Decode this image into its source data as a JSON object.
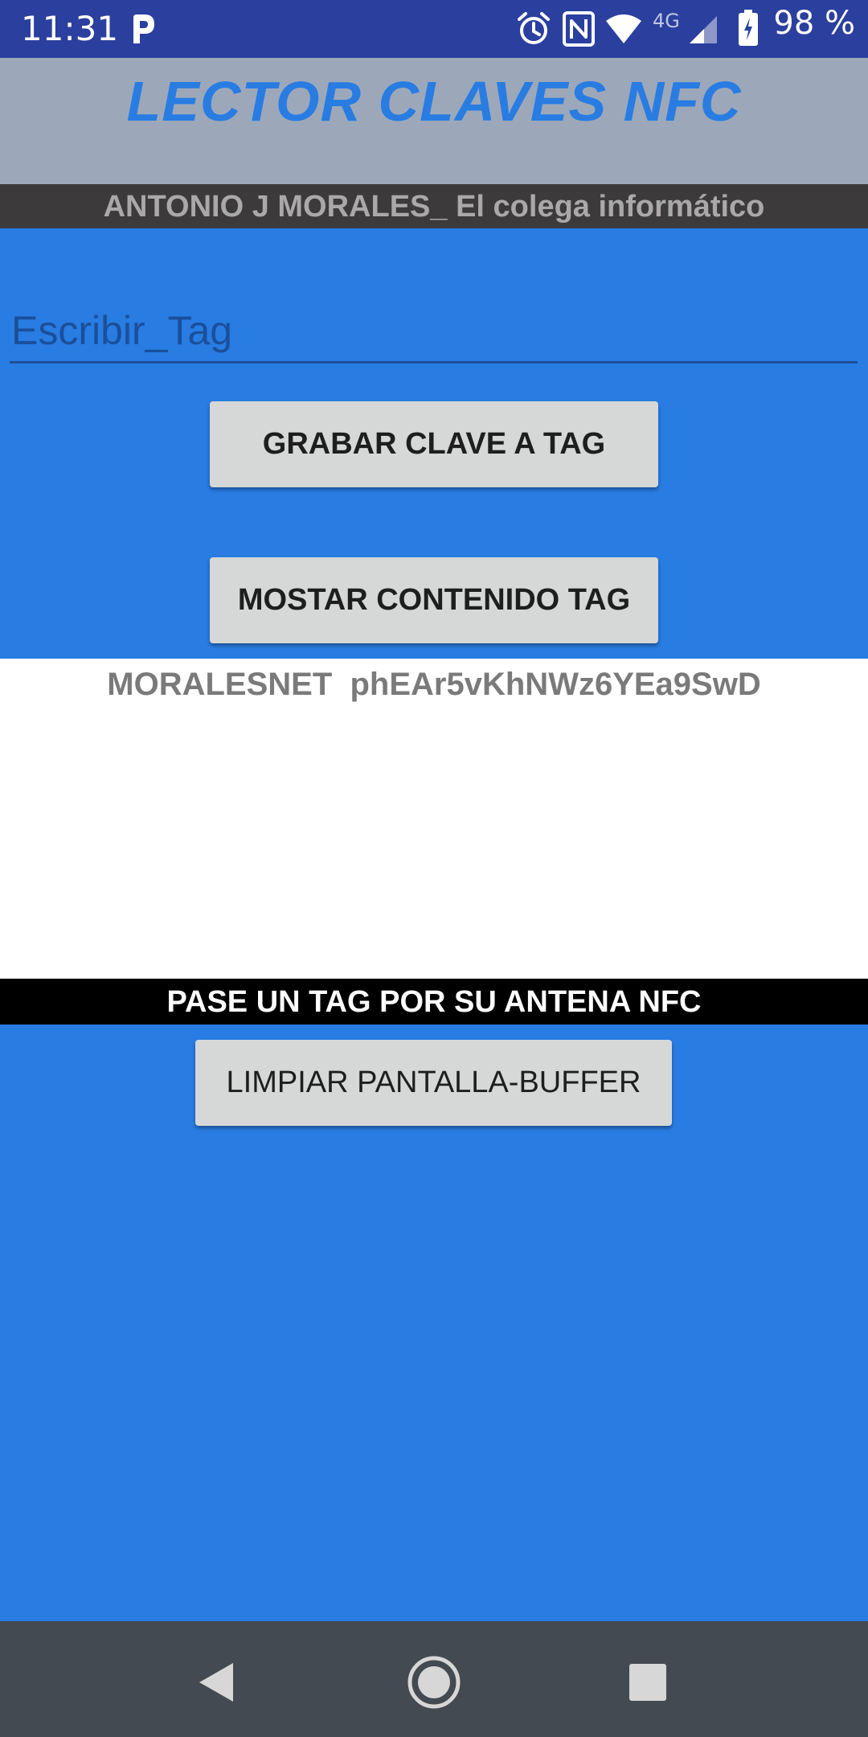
{
  "status_bar": {
    "time": "11:31",
    "network": "4G",
    "battery": "98 %",
    "icons": [
      "p-app-icon",
      "alarm-icon",
      "nfc-icon",
      "wifi-icon",
      "signal-icon",
      "battery-charging-icon"
    ]
  },
  "header": {
    "title": "LECTOR CLAVES NFC",
    "author": "ANTONIO J MORALES_ El colega informático"
  },
  "input": {
    "placeholder": "Escribir_Tag",
    "value": ""
  },
  "buttons": {
    "write_tag": "GRABAR CLAVE A TAG",
    "show_tag": "MOSTAR CONTENIDO TAG",
    "clear": "LIMPIAR PANTALLA-BUFFER"
  },
  "output": {
    "content": "MORALESNET  phEAr5vKhNWz6YEa9SwD"
  },
  "nfc_prompt": "PASE UN TAG POR SU ANTENA NFC",
  "colors": {
    "status_bar": "#2B3F9E",
    "accent_blue": "#287CE2",
    "header_grey": "#9CA8BA",
    "author_bar": "#3D3A3B",
    "button": "#D6D7D7",
    "nav_bar": "#434A51"
  },
  "nav": {
    "icons": [
      "back-icon",
      "home-icon",
      "recents-icon"
    ]
  }
}
